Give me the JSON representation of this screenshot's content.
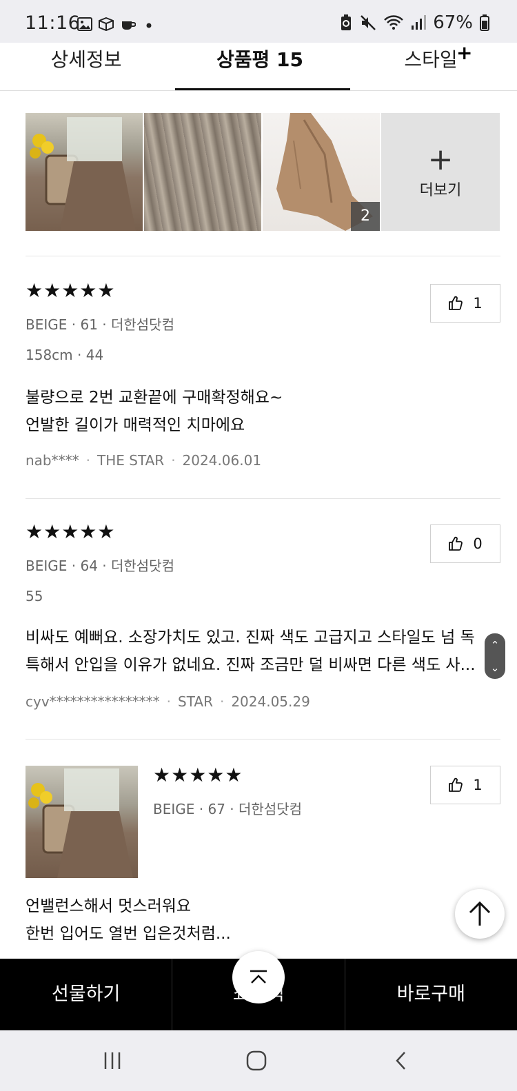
{
  "status_bar": {
    "time": "11:16",
    "battery_percent": "67%",
    "icons": [
      "image-icon",
      "box-icon",
      "coffee-icon",
      "dot-icon",
      "battery-saver-icon",
      "mute-icon",
      "wifi-icon",
      "signal-icon",
      "battery-icon"
    ]
  },
  "tabs": [
    {
      "label": "상세정보",
      "active": false
    },
    {
      "label": "상품평 15",
      "active": true
    },
    {
      "label": "스타일",
      "active": false
    }
  ],
  "tabs_plus": "+",
  "photos": {
    "more_label": "더보기",
    "more_plus": "+",
    "badge_count": "2"
  },
  "reviews": [
    {
      "rating": "★★★★★",
      "meta1": "BEIGE · 61 · 더한섬닷컴",
      "meta2": "158cm · 44",
      "text_line1": "불량으로 2번 교환끝에 구매확정해요~",
      "text_line2": "언발한 길이가 매력적인 치마에요",
      "author": "nab****",
      "grade": "THE STAR",
      "date": "2024.06.01",
      "likes": "1"
    },
    {
      "rating": "★★★★★",
      "meta1": "BEIGE · 64 · 더한섬닷컴",
      "meta2": "55",
      "text_line1": "비싸도 예뻐요. 소장가치도 있고. 진짜 색도 고급지고 스타일도 넘 독",
      "text_line2": "특해서 안입을 이유가 없네요. 진짜 조금만 덜 비싸면 다른 색도 사...",
      "author": "cyv****************",
      "grade": "STAR",
      "date": "2024.05.29",
      "likes": "0"
    },
    {
      "rating": "★★★★★",
      "meta1": "BEIGE · 67 · 더한섬닷컴",
      "text_line1": "언밸런스해서 멋스러워요",
      "text_line2": "한번 입어도 열번 입은것처럼...",
      "likes": "1"
    }
  ],
  "bottom_bar": {
    "gift": "선물하기",
    "cart": "쇼핑백",
    "buy": "바로구매"
  },
  "scroll_widget": {
    "up": "⌃",
    "down": "⌄"
  }
}
